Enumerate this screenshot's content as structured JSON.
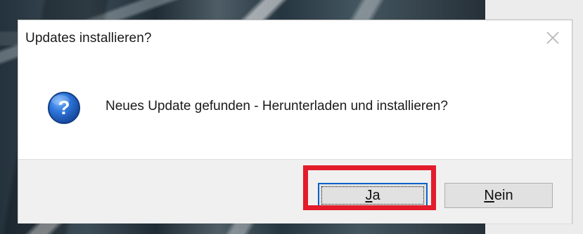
{
  "dialog": {
    "title": "Updates installieren?",
    "message": "Neues Update gefunden - Herunterladen und installieren?",
    "icon": "question-icon",
    "close_icon": "close-icon",
    "buttons": {
      "yes": {
        "label_rest": "a",
        "mnemonic": "J"
      },
      "no": {
        "label_rest": "ein",
        "mnemonic": "N"
      }
    }
  },
  "annotation": {
    "highlight_color": "#e31b2b"
  },
  "colors": {
    "accent": "#0a63c9",
    "dialog_bg": "#ffffff",
    "footer_bg": "#f0f0f0",
    "button_bg": "#e1e1e1",
    "button_border": "#adadad"
  }
}
